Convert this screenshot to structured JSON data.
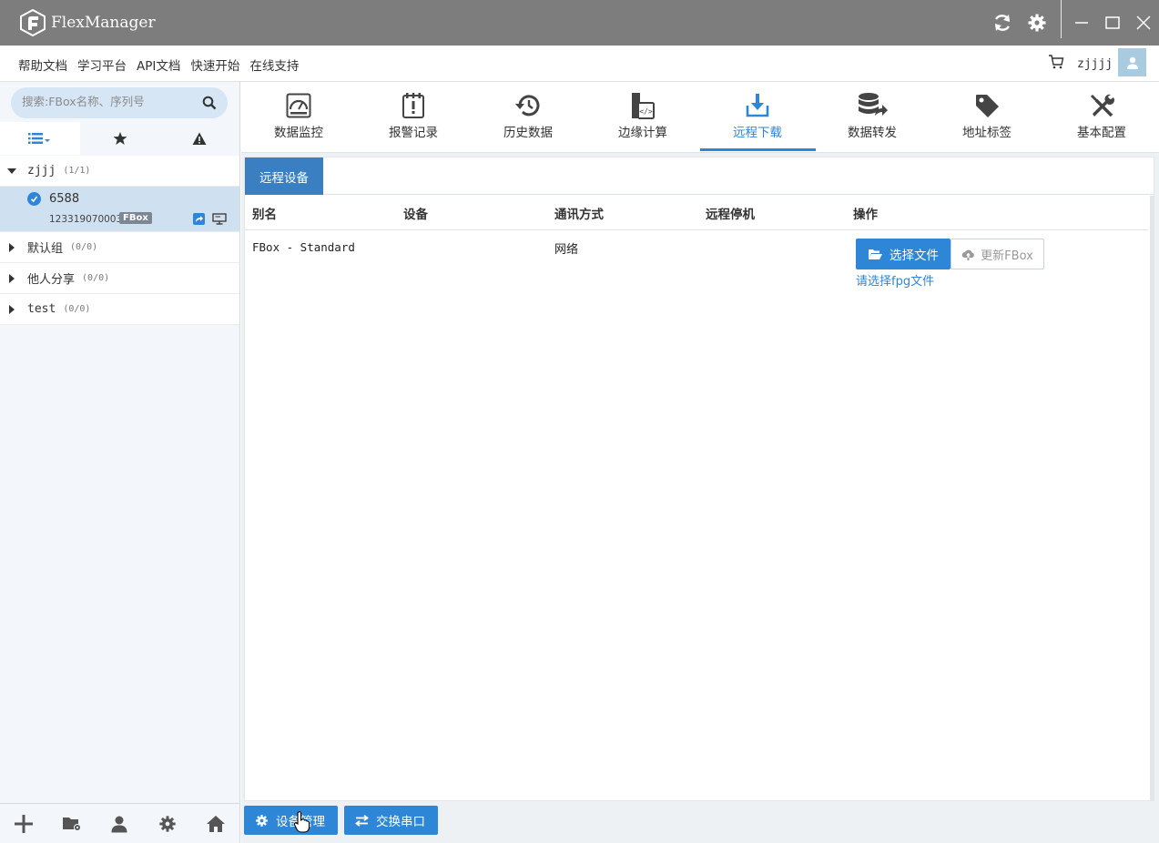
{
  "app": {
    "title": "FlexManager"
  },
  "menu": {
    "links": [
      "帮助文档",
      "学习平台",
      "API文档",
      "快速开始",
      "在线支持"
    ]
  },
  "user": {
    "name": "zjjjj"
  },
  "sidebar": {
    "search_placeholder": "搜索:FBox名称、序列号",
    "groups": [
      {
        "name": "zjjj",
        "count": "(1/1)",
        "expanded": true
      },
      {
        "name": "默认组",
        "count": "(0/0)"
      },
      {
        "name": "他人分享",
        "count": "(0/0)"
      },
      {
        "name": "test",
        "count": "(0/0)"
      }
    ],
    "device": {
      "name": "6588",
      "serial": "123319070003",
      "badge": "FBox"
    }
  },
  "toolbar": {
    "items": [
      "数据监控",
      "报警记录",
      "历史数据",
      "边缘计算",
      "远程下载",
      "数据转发",
      "地址标签",
      "基本配置"
    ],
    "active": "远程下载"
  },
  "panel": {
    "tab": "远程设备",
    "columns": [
      "别名",
      "设备",
      "通讯方式",
      "远程停机",
      "操作"
    ],
    "row": {
      "alias": "FBox - Standard",
      "device": "",
      "comm": "网络",
      "remote_stop": "",
      "select_file_label": "选择文件",
      "update_label": "更新FBox",
      "hint": "请选择fpg文件"
    }
  },
  "bottom": {
    "device_manage": "设备管理",
    "swap_serial": "交换串口"
  },
  "colors": {
    "accent": "#2e86d6",
    "titlebar": "#7d7d7d",
    "tab_active": "#3a7fc2"
  }
}
